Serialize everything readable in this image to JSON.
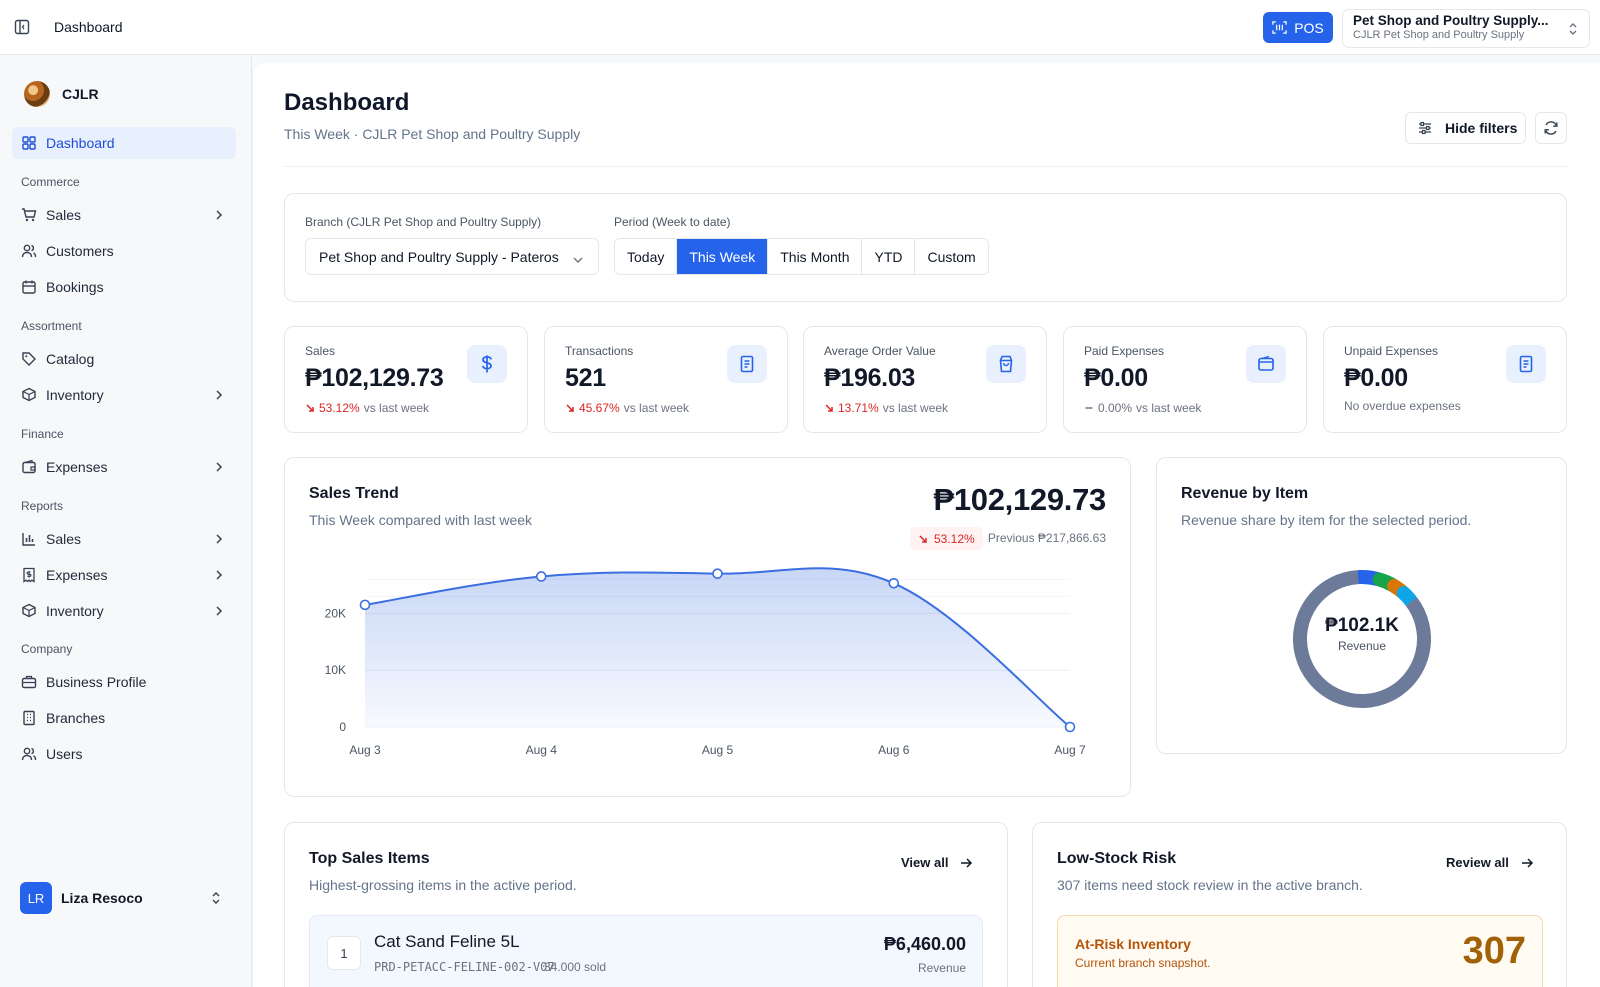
{
  "topbar": {
    "breadcrumb": "Dashboard",
    "pos_label": "POS",
    "store_name": "Pet Shop and Poultry Supply...",
    "store_sub": "CJLR Pet Shop and Poultry Supply"
  },
  "sidebar": {
    "org_name": "CJLR",
    "dashboard": "Dashboard",
    "sections": {
      "commerce": "Commerce",
      "assortment": "Assortment",
      "finance": "Finance",
      "reports": "Reports",
      "company": "Company"
    },
    "items": {
      "sales": "Sales",
      "customers": "Customers",
      "bookings": "Bookings",
      "catalog": "Catalog",
      "inventory": "Inventory",
      "expenses": "Expenses",
      "report_sales": "Sales",
      "report_expenses": "Expenses",
      "report_inventory": "Inventory",
      "business_profile": "Business Profile",
      "branches": "Branches",
      "users": "Users"
    },
    "user": {
      "initials": "LR",
      "name": "Liza Resoco"
    }
  },
  "page": {
    "title": "Dashboard",
    "subtitle": "This Week · CJLR Pet Shop and Poultry Supply",
    "hide_filters": "Hide filters"
  },
  "filters": {
    "branch_label": "Branch (CJLR Pet Shop and Poultry Supply)",
    "branch_value": "Pet Shop and Poultry Supply - Pateros",
    "period_label": "Period (Week to date)",
    "periods": [
      "Today",
      "This Week",
      "This Month",
      "YTD",
      "Custom"
    ],
    "active_period": "This Week"
  },
  "kpis": [
    {
      "label": "Sales",
      "value": "₱102,129.73",
      "change": "53.12%",
      "note": "vs last week"
    },
    {
      "label": "Transactions",
      "value": "521",
      "change": "45.67%",
      "note": "vs last week"
    },
    {
      "label": "Average Order Value",
      "value": "₱196.03",
      "change": "13.71%",
      "note": "vs last week"
    },
    {
      "label": "Paid Expenses",
      "value": "₱0.00",
      "change": "0.00%",
      "note": "vs last week"
    },
    {
      "label": "Unpaid Expenses",
      "value": "₱0.00",
      "note": "No overdue expenses"
    }
  ],
  "trend": {
    "title": "Sales Trend",
    "subtitle": "This Week compared with last week",
    "total": "₱102,129.73",
    "change": "53.12%",
    "previous": "Previous ₱217,866.63"
  },
  "chart_data": {
    "type": "area",
    "categories": [
      "Aug 3",
      "Aug 4",
      "Aug 5",
      "Aug 6",
      "Aug 7"
    ],
    "values": [
      21500,
      26500,
      27000,
      25300,
      0
    ],
    "y_ticks": [
      "0",
      "10K",
      "20K"
    ],
    "ylim": [
      0,
      25000
    ],
    "grid": true,
    "color": "#3b6fe0"
  },
  "revenue": {
    "title": "Revenue by Item",
    "subtitle": "Revenue share by item for the selected period.",
    "center_value": "₱102.1K",
    "center_label": "Revenue",
    "segments": [
      {
        "share": 0.83,
        "color": "#6b7b99"
      },
      {
        "share": 0.05,
        "color": "#2563eb"
      },
      {
        "share": 0.04,
        "color": "#16a34a"
      },
      {
        "share": 0.03,
        "color": "#d97706"
      },
      {
        "share": 0.03,
        "color": "#0ea5e9"
      }
    ]
  },
  "top_sales": {
    "title": "Top Sales Items",
    "subtitle": "Highest-grossing items in the active period.",
    "view_all": "View all",
    "items": [
      {
        "rank": "1",
        "name": "Cat Sand Feline 5L",
        "sku": "PRD-PETACC-FELINE-002-V07",
        "sold": "34.000 sold",
        "revenue": "₱6,460.00",
        "revenue_label": "Revenue"
      }
    ]
  },
  "low_stock": {
    "title": "Low-Stock Risk",
    "subtitle": "307 items need stock review in the active branch.",
    "review_all": "Review all",
    "box_title": "At-Risk Inventory",
    "box_sub": "Current branch snapshot.",
    "count": "307"
  }
}
